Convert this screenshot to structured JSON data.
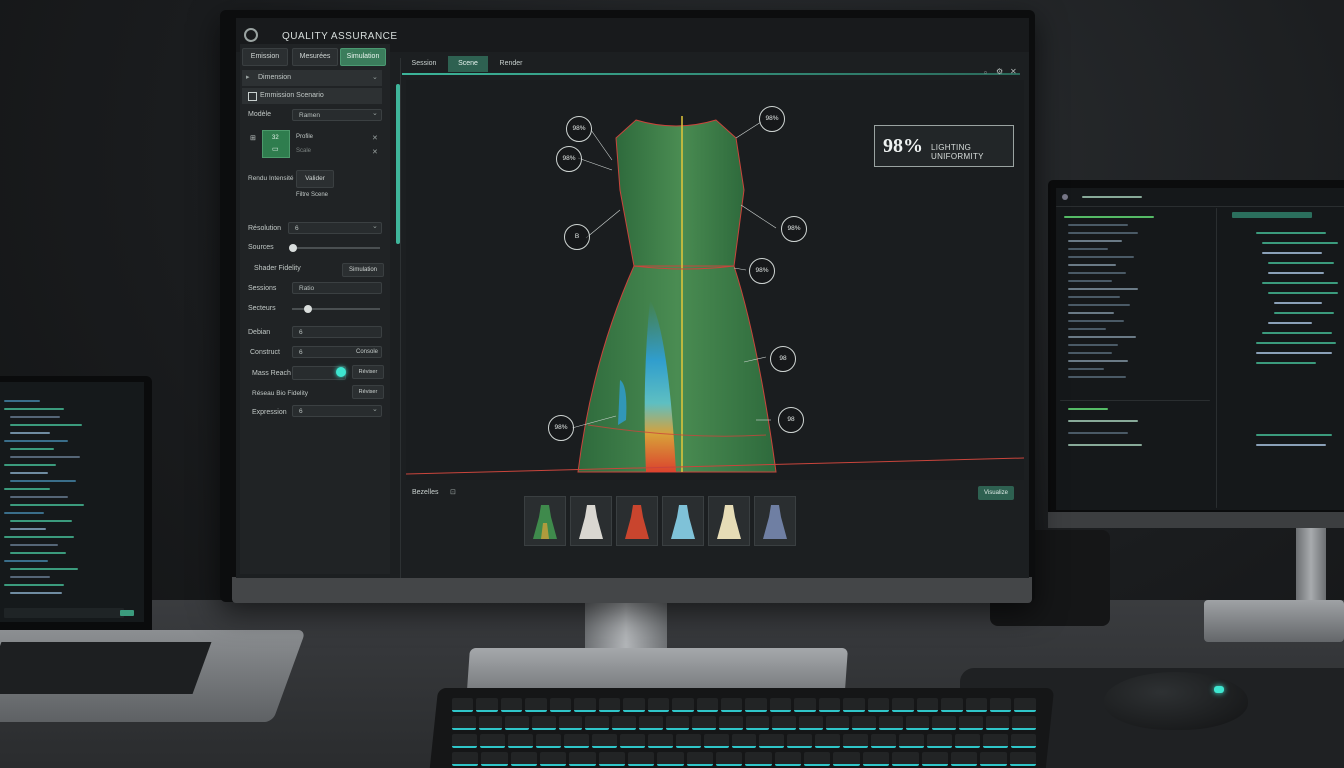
{
  "app": {
    "title": "QUALITY ASSURANCE"
  },
  "left_panel": {
    "top_buttons": [
      "Emission",
      "Mesurées",
      "Simulation"
    ],
    "rows": {
      "r1_label": "Dimension",
      "r2_label": "Emmission Scenario",
      "r3_label": "Modèle",
      "r3_value": "Ramen",
      "swatch_label": "32",
      "side_a": "Profile",
      "side_b": "Scale",
      "r4_label": "Rendu Intensité",
      "r4_button": "Valider",
      "r4_sub": "Filtre Scene",
      "r5_label": "Résolution",
      "r5_value": "6",
      "r6_label": "Sources",
      "r7_label": "Shader Fidelity",
      "r7_button": "Simulation",
      "r8_label": "Sessions",
      "r8_value": "Ratio",
      "r9_label": "Secteurs",
      "r10_label": "Debian",
      "r10_value": "6",
      "r11_label": "Construct",
      "r11_value": "6",
      "r11_extra": "Console",
      "r12_label": "Mass Reach",
      "r12_button": "Réviser",
      "r13_label": "Réseau Bio Fidelity",
      "r13_button": "Réviser",
      "r14_label": "Expression",
      "r14_value": "6"
    }
  },
  "tabs": [
    "Session",
    "Scene",
    "Render"
  ],
  "window_controls": [
    "minimize-icon",
    "maximize-icon",
    "close-icon"
  ],
  "overlay": {
    "percent": "98%",
    "label": "LIGHTING UNIFORMITY"
  },
  "measurements": [
    "98%",
    "98%",
    "98%",
    "B",
    "98%",
    "98%",
    "98",
    "98%",
    "98"
  ],
  "bottom_bar": {
    "label": "Bezelles",
    "button": "Visualize"
  },
  "variants": [
    "green",
    "white",
    "red",
    "light-blue",
    "cream",
    "blue-gray"
  ],
  "colors": {
    "accent": "#3fb59a",
    "garment": "#3f7d4a",
    "seam": "#c9453c",
    "center_line": "#e2c73a"
  }
}
